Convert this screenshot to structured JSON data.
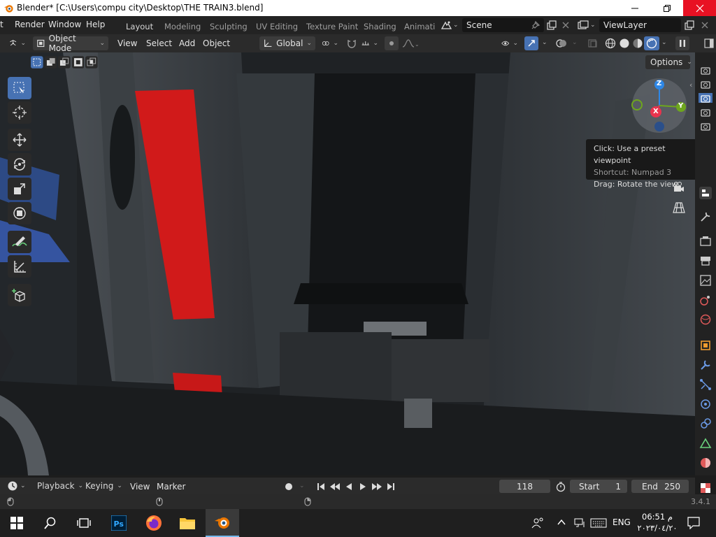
{
  "window": {
    "title": "Blender* [C:\\Users\\compu city\\Desktop\\THE TRAIN3.blend]"
  },
  "topbar": {
    "menus": [
      "t",
      "Render",
      "Window",
      "Help"
    ],
    "workspaces": [
      "Layout",
      "Modeling",
      "Sculpting",
      "UV Editing",
      "Texture Paint",
      "Shading",
      "Animati"
    ],
    "active_workspace": "Layout",
    "scene": "Scene",
    "view_layer": "ViewLayer"
  },
  "header": {
    "mode": "Object Mode",
    "menus": [
      "View",
      "Select",
      "Add",
      "Object"
    ],
    "orientation": "Global"
  },
  "viewport": {
    "options_label": "Options",
    "gizmo_axes": [
      "Z",
      "X",
      "Y"
    ],
    "tooltip": {
      "line1": "Click: Use a preset viewpoint",
      "line2": "Shortcut: Numpad 3",
      "line3": "Drag: Rotate the view"
    }
  },
  "toolbar": {
    "tools": [
      "select-box",
      "cursor",
      "move",
      "rotate",
      "scale",
      "transform",
      "annotate",
      "measure",
      "add-cube"
    ],
    "active_tool": "select-box"
  },
  "timeline": {
    "menus": [
      "Playback",
      "Keying",
      "View",
      "Marker"
    ],
    "current_frame": "118",
    "start_label": "Start",
    "start_value": "1",
    "end_label": "End",
    "end_value": "250"
  },
  "statusbar": {
    "version": "3.4.1"
  },
  "taskbar": {
    "language": "ENG",
    "time": "06:51 م",
    "date": "٢٠٢٣/٠٤/٢٠"
  },
  "colors": {
    "accent": "#4772b3",
    "close_red": "#e81123",
    "gizmo_x": "#e8344e",
    "gizmo_y": "#6ea61d",
    "gizmo_z": "#2e87e6",
    "train_red": "#d11a1a"
  }
}
